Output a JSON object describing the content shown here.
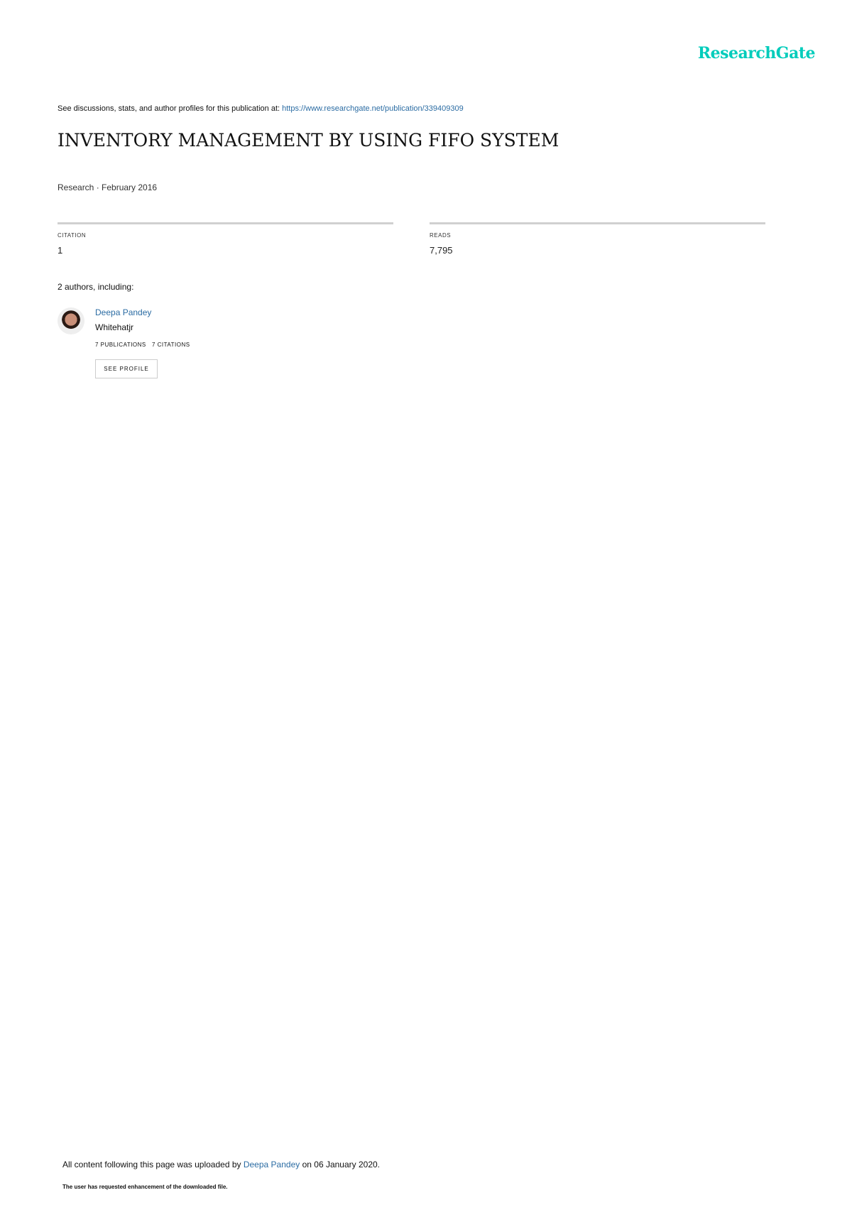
{
  "logo": "ResearchGate",
  "header": {
    "see_text": "See discussions, stats, and author profiles for this publication at: ",
    "url": "https://www.researchgate.net/publication/339409309"
  },
  "title": "INVENTORY MANAGEMENT BY USING FIFO SYSTEM",
  "pub_type": "Research · February 2016",
  "stats": {
    "citation_label": "CITATION",
    "citation_value": "1",
    "reads_label": "READS",
    "reads_value": "7,795"
  },
  "authors_heading": "2 authors, including:",
  "author": {
    "name": "Deepa Pandey",
    "affiliation": "Whitehatjr",
    "publications": "7 PUBLICATIONS",
    "citations": "7 CITATIONS",
    "button": "SEE PROFILE"
  },
  "footer": {
    "prefix": "All content following this page was uploaded by ",
    "uploader": "Deepa Pandey",
    "suffix": " on 06 January 2020.",
    "note": "The user has requested enhancement of the downloaded file."
  }
}
